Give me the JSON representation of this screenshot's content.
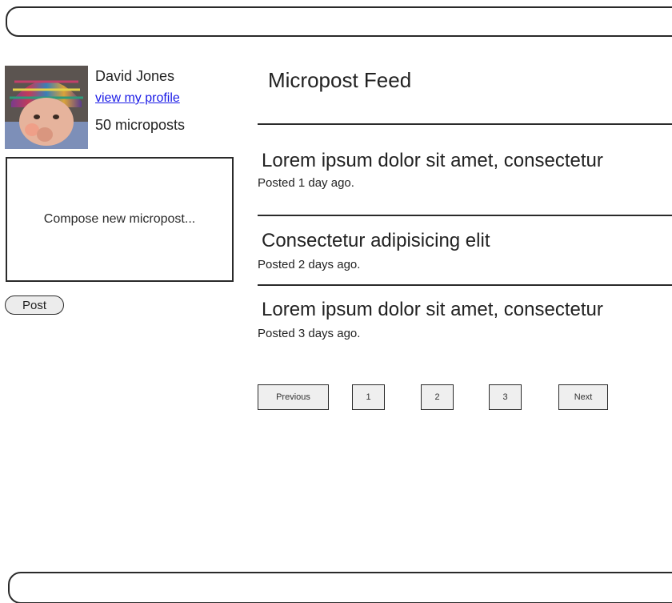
{
  "user": {
    "name": "David Jones",
    "profile_link": "view my profile",
    "micropost_count": "50 microposts"
  },
  "compose": {
    "placeholder": "Compose new micropost...",
    "post_label": "Post"
  },
  "feed": {
    "title": "Micropost Feed",
    "posts": [
      {
        "content": "Lorem ipsum dolor sit amet, consectetur",
        "time": "Posted 1 day ago."
      },
      {
        "content": "Consectetur adipisicing elit",
        "time": "Posted 2 days ago."
      },
      {
        "content": "Lorem ipsum dolor sit amet, consectetur",
        "time": "Posted 3 days ago."
      }
    ]
  },
  "pagination": {
    "previous": "Previous",
    "pages": [
      "1",
      "2",
      "3"
    ],
    "next": "Next"
  }
}
